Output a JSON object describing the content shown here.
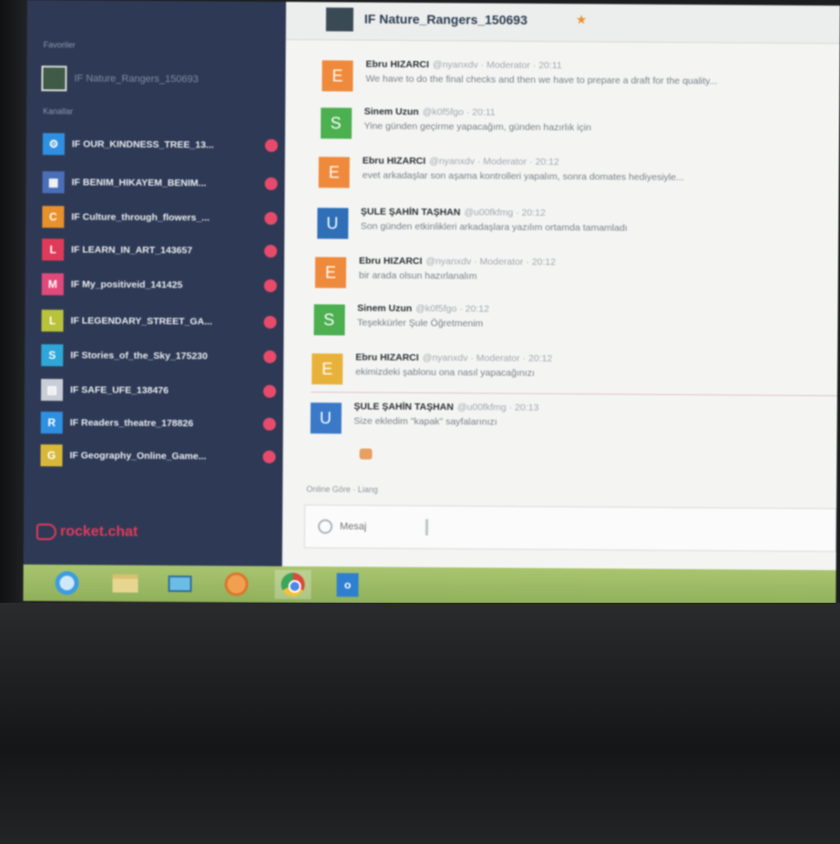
{
  "sidebar": {
    "favorites_heading": "Favoriler",
    "favorite": {
      "name": "IF Nature_Rangers_150693"
    },
    "channels_heading": "Kanallar",
    "rooms": [
      {
        "initial": "⚙",
        "name": "IF OUR_KINDNESS_TREE_13...",
        "color": "#2f8fe0"
      },
      {
        "initial": "▦",
        "name": "IF BENIM_HIKAYEM_BENIM...",
        "color": "#4a6fb8"
      },
      {
        "initial": "C",
        "name": "IF Culture_through_flowers_...",
        "color": "#e8902b"
      },
      {
        "initial": "L",
        "name": "IF LEARN_IN_ART_143657",
        "color": "#e03a5a"
      },
      {
        "initial": "M",
        "name": "IF My_positiveid_141425",
        "color": "#e0497a"
      },
      {
        "initial": "L",
        "name": "IF LEGENDARY_STREET_GA...",
        "color": "#b8c23a"
      },
      {
        "initial": "S",
        "name": "IF Stories_of_the_Sky_175230",
        "color": "#2fa6d8"
      },
      {
        "initial": "▤",
        "name": "IF SAFE_UFE_138476",
        "color": "#c9cdd6"
      },
      {
        "initial": "R",
        "name": "IF Readers_theatre_178826",
        "color": "#2f8fe0"
      },
      {
        "initial": "G",
        "name": "IF Geography_Online_Game...",
        "color": "#d8b83a"
      }
    ],
    "brand": "rocket.chat"
  },
  "header": {
    "title": "IF Nature_Rangers_150693",
    "star": "★"
  },
  "messages": [
    {
      "initial": "E",
      "color": "#ef8a3c",
      "author": "Ebru HIZARCI",
      "handle": "@nyanxdv · Moderator · 20:11",
      "text": "We have to do the final checks and then we have to prepare a draft for the quality..."
    },
    {
      "initial": "S",
      "color": "#4caf50",
      "author": "Sinem Uzun",
      "handle": "@k0f5fgo · 20:11",
      "text": "Yine günden geçirme yapacağım, günden hazırlık için"
    },
    {
      "initial": "E",
      "color": "#ef8a3c",
      "author": "Ebru HIZARCI",
      "handle": "@nyanxdv · Moderator · 20:12",
      "text": "evet arkadaşlar son aşama kontrolleri yapalım, sonra domates hediyesiyle..."
    },
    {
      "initial": "U",
      "color": "#2f6fb8",
      "author": "ŞULE ŞAHİN TAŞHAN",
      "handle": "@u00fkfmg · 20:12",
      "text": "Son günden etkinlikleri arkadaşlara yazılım ortamda tamamladı"
    },
    {
      "initial": "E",
      "color": "#ef8a3c",
      "author": "Ebru HIZARCI",
      "handle": "@nyanxdv · Moderator · 20:12",
      "text": "bir arada olsun hazırlanalım"
    },
    {
      "initial": "S",
      "color": "#4caf50",
      "author": "Sinem Uzun",
      "handle": "@k0f5fgo · 20:12",
      "text": "Teşekkürler Şule Öğretmenim"
    },
    {
      "initial": "E",
      "color": "#e8b23a",
      "author": "Ebru HIZARCI",
      "handle": "@nyanxdv · Moderator · 20:12",
      "text": "ekimizdeki şablonu ona nasıl yapacağınızı"
    },
    {
      "initial": "U",
      "color": "#3a78c8",
      "author": "ŞULE ŞAHİN TAŞHAN",
      "handle": "@u00fkfmg · 20:13",
      "text": "Size ekledim \"kapak\" sayfalarınızı"
    }
  ],
  "composer": {
    "typing": "Online Göre · Liang",
    "placeholder": "Mesaj"
  }
}
